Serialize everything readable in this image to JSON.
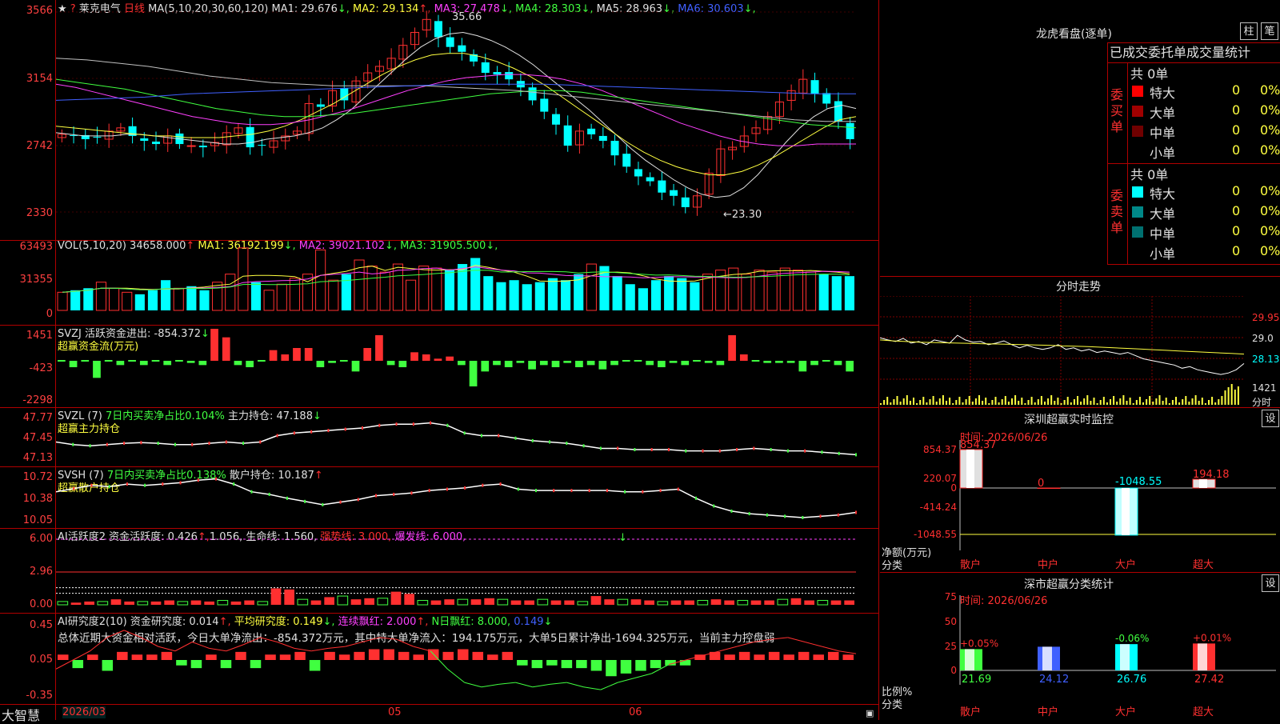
{
  "main": {
    "star": "★",
    "question": "?",
    "stock_name": "莱克电气",
    "period": "日线",
    "ma_params": "MA(5,10,20,30,60,120)",
    "ma": [
      {
        "label": "MA1: 29.676",
        "arrow": "↓",
        "color": "#e0e0e0"
      },
      {
        "label": "MA2: 29.134",
        "arrow": "↑",
        "color": "#ffff40"
      },
      {
        "label": "MA3: 27.478",
        "arrow": "↓",
        "color": "#ff40ff"
      },
      {
        "label": "MA4: 28.303",
        "arrow": "↓",
        "color": "#40ff40"
      },
      {
        "label": "MA5: 28.963",
        "arrow": "↓",
        "color": "#e0e0e0"
      },
      {
        "label": "MA6: 30.603",
        "arrow": "↓",
        "color": "#4060ff"
      }
    ],
    "y_labels": [
      "3566",
      "3154",
      "2742",
      "2330"
    ],
    "high_mark": "35.66",
    "low_mark": "←23.30",
    "closes": [
      28.1,
      28.0,
      27.8,
      27.9,
      28.3,
      28.5,
      28.0,
      27.7,
      27.5,
      28.0,
      27.5,
      27.4,
      27.3,
      27.6,
      28.2,
      28.5,
      27.3,
      27.4,
      27.7,
      28.0,
      28.3,
      30.0,
      29.8,
      30.8,
      30.2,
      31.4,
      31.9,
      32.3,
      32.8,
      33.6,
      34.4,
      35.2,
      34.1,
      33.5,
      33.2,
      32.6,
      31.9,
      31.8,
      31.5,
      31.0,
      30.2,
      29.5,
      28.7,
      27.4,
      28.3,
      28.1,
      27.7,
      26.8,
      26.1,
      25.5,
      25.2,
      24.5,
      24.3,
      23.6,
      24.3,
      25.7,
      27.2,
      27.3,
      28.0,
      28.5,
      29.2,
      30.1,
      30.8,
      31.5,
      30.6,
      30.0,
      28.9,
      27.8
    ],
    "ma_lines": [
      {
        "color": "#e0e0e0",
        "values": [
          28.2,
          28.1,
          28.0,
          28.0,
          28.0,
          28.1,
          28.1,
          28.0,
          27.9,
          27.8,
          27.7,
          27.6,
          27.5,
          27.5,
          27.6,
          27.8,
          27.9,
          28.0,
          28.2,
          28.5,
          29.0,
          29.6,
          30.4,
          31.2,
          32.0,
          32.8,
          33.5,
          34.0,
          34.3,
          34.4,
          34.2,
          33.9,
          33.5,
          33.0,
          32.4,
          31.7,
          31.0,
          30.3,
          29.6,
          28.8,
          28.0,
          27.2,
          26.5,
          25.9,
          25.3,
          24.8,
          24.4,
          24.2,
          24.3,
          24.8,
          25.6,
          26.6,
          27.6,
          28.5,
          29.2,
          29.7,
          29.9,
          29.7
        ]
      },
      {
        "color": "#ffff40",
        "values": [
          28.6,
          28.5,
          28.4,
          28.3,
          28.2,
          28.1,
          28.0,
          28.0,
          27.9,
          27.9,
          27.9,
          28.0,
          28.1,
          28.3,
          28.6,
          29.0,
          29.5,
          30.0,
          30.6,
          31.2,
          31.8,
          32.3,
          32.7,
          33.0,
          33.1,
          33.1,
          32.9,
          32.6,
          32.2,
          31.7,
          31.1,
          30.4,
          29.7,
          29.0,
          28.3,
          27.6,
          27.0,
          26.5,
          26.1,
          25.8,
          25.6,
          25.6,
          25.8,
          26.2,
          26.7,
          27.3,
          27.9,
          28.5,
          29.0,
          29.2
        ]
      },
      {
        "color": "#ff40ff",
        "values": [
          31.2,
          31.0,
          30.7,
          30.4,
          30.1,
          29.8,
          29.5,
          29.2,
          29.0,
          28.8,
          28.7,
          28.7,
          28.8,
          29.0,
          29.3,
          29.6,
          30.0,
          30.4,
          30.8,
          31.1,
          31.4,
          31.6,
          31.7,
          31.8,
          31.8,
          31.7,
          31.5,
          31.2,
          30.8,
          30.3,
          29.8,
          29.3,
          28.8,
          28.4,
          28.0,
          27.7,
          27.5,
          27.4,
          27.4,
          27.5,
          27.5,
          27.5
        ]
      },
      {
        "color": "#40ff40",
        "values": [
          31.5,
          31.3,
          31.1,
          30.9,
          30.6,
          30.3,
          30.0,
          29.7,
          29.5,
          29.3,
          29.2,
          29.2,
          29.3,
          29.4,
          29.6,
          29.8,
          30.0,
          30.2,
          30.4,
          30.6,
          30.7,
          30.8,
          30.8,
          30.7,
          30.5,
          30.3,
          30.1,
          29.9,
          29.7,
          29.5,
          29.3,
          29.1,
          28.9,
          28.7,
          28.6,
          28.5
        ]
      },
      {
        "color": "#c0c0c0",
        "values": [
          32.8,
          32.7,
          32.5,
          32.3,
          32.0,
          31.7,
          31.5,
          31.3,
          31.2,
          31.1,
          31.1,
          31.1,
          31.1,
          31.0,
          30.9,
          30.8,
          30.6,
          30.4,
          30.2,
          30.0,
          29.8,
          29.6,
          29.4,
          29.2,
          29.0,
          28.9,
          28.9
        ]
      },
      {
        "color": "#4060ff",
        "values": [
          30.2,
          30.3,
          30.4,
          30.6,
          30.7,
          30.8,
          30.9,
          31.0,
          31.1,
          31.2,
          31.2,
          31.2,
          31.1,
          31.0,
          30.9,
          30.8,
          30.7,
          30.6,
          30.6
        ]
      }
    ]
  },
  "vol": {
    "header": "VOL(5,10,20)",
    "value": "34658.000",
    "arrow": "↑",
    "ma": [
      {
        "label": "MA1: 36192.199",
        "arrow": "↓",
        "color": "#ffff40"
      },
      {
        "label": "MA2: 39021.102",
        "arrow": "↓",
        "color": "#ff40ff"
      },
      {
        "label": "MA3: 31905.500",
        "arrow": "↓",
        "color": "#40ff40"
      }
    ],
    "y_labels": [
      "63493",
      "31355",
      "0"
    ],
    "values": [
      18000,
      20000,
      22000,
      28000,
      22000,
      18000,
      16000,
      20000,
      30000,
      22000,
      24000,
      20000,
      28000,
      36000,
      62000,
      28000,
      20000,
      26000,
      32000,
      36000,
      60000,
      30000,
      36000,
      50000,
      44000,
      38000,
      46000,
      30000,
      44000,
      42000,
      40000,
      46000,
      52000,
      34000,
      28000,
      30000,
      26000,
      28000,
      32000,
      30000,
      36000,
      46000,
      44000,
      34000,
      26000,
      22000,
      30000,
      34000,
      32000,
      28000,
      36000,
      40000,
      42000,
      36000,
      40000,
      38000,
      42000,
      40000,
      38000,
      36000,
      34000,
      34000
    ]
  },
  "svzj": {
    "name": "SVZJ",
    "label": "活跃资金进出: -854.372",
    "arrow": "↓",
    "title": "超赢资金流(万元)",
    "y_labels": [
      "1451",
      "-423",
      "-2298"
    ],
    "values": [
      0,
      -300,
      0,
      -800,
      0,
      -200,
      0,
      -200,
      0,
      -200,
      0,
      -100,
      -200,
      1500,
      1100,
      -200,
      -300,
      0,
      500,
      300,
      600,
      600,
      -300,
      -100,
      0,
      -500,
      600,
      1200,
      -200,
      -300,
      400,
      300,
      100,
      200,
      -200,
      -1200,
      -500,
      -200,
      -300,
      -100,
      -400,
      -200,
      -300,
      -100,
      -300,
      -200,
      -400,
      -200,
      0,
      0,
      -200,
      -300,
      -100,
      -200,
      0,
      -100,
      -200,
      1200,
      300,
      0,
      -100,
      -100,
      -100,
      -500,
      -200,
      0,
      -200,
      -500
    ]
  },
  "svzl": {
    "name": "SVZL (7)",
    "label1": "7日内买卖净占比0.104%",
    "label2": "主力持仓: 47.188",
    "arrow": "↓",
    "title": "超赢主力持仓",
    "y_labels": [
      "47.77",
      "47.45",
      "47.13"
    ],
    "values": [
      47.4,
      47.36,
      47.34,
      47.36,
      47.38,
      47.39,
      47.38,
      47.36,
      47.36,
      47.38,
      47.4,
      47.38,
      47.4,
      47.5,
      47.54,
      47.56,
      47.58,
      47.6,
      47.62,
      47.66,
      47.68,
      47.68,
      47.7,
      47.66,
      47.54,
      47.5,
      47.5,
      47.46,
      47.42,
      47.4,
      47.38,
      47.34,
      47.3,
      47.3,
      47.28,
      47.28,
      47.28,
      47.26,
      47.26,
      47.26,
      47.28,
      47.3,
      47.28,
      47.26,
      47.26,
      47.24,
      47.22,
      47.2
    ]
  },
  "svsh": {
    "name": "SVSH (7)",
    "label1": "7日内买卖净占比0.138%",
    "label2": "散户持仓: 10.187",
    "arrow": "↑",
    "title": "超赢散户持仓",
    "y_labels": [
      "10.72",
      "10.38",
      "10.05"
    ],
    "values": [
      10.5,
      10.55,
      10.6,
      10.58,
      10.62,
      10.6,
      10.62,
      10.64,
      10.68,
      10.7,
      10.62,
      10.5,
      10.46,
      10.4,
      10.35,
      10.3,
      10.34,
      10.38,
      10.44,
      10.46,
      10.48,
      10.52,
      10.54,
      10.56,
      10.6,
      10.62,
      10.54,
      10.52,
      10.52,
      10.52,
      10.52,
      10.52,
      10.5,
      10.5,
      10.52,
      10.54,
      10.4,
      10.28,
      10.2,
      10.16,
      10.14,
      10.12,
      10.1,
      10.12,
      10.14,
      10.18
    ]
  },
  "ai1": {
    "name": "AI活跃度2",
    "label1": "资金活跃度: 0.426",
    "sep": "↑,",
    "label2": "1.056,",
    "label3": "生命线: 1.560,",
    "label4": "强势线: 3.000,",
    "label5": "爆发线: 6.000,",
    "y_labels": [
      "6.00",
      "2.96",
      "0.00"
    ],
    "values": [
      0.3,
      0.2,
      0.3,
      0.3,
      0.5,
      0.3,
      0.3,
      0.3,
      0.4,
      0.3,
      0.4,
      0.3,
      0.4,
      0.3,
      0.4,
      0.3,
      1.5,
      1.4,
      0.5,
      0.4,
      0.7,
      0.8,
      0.5,
      0.6,
      0.6,
      1.2,
      1.0,
      0.4,
      0.4,
      0.5,
      0.5,
      0.5,
      0.6,
      0.5,
      0.4,
      0.4,
      0.5,
      0.4,
      0.4,
      0.3,
      0.8,
      0.5,
      0.5,
      0.5,
      0.4,
      0.3,
      0.4,
      0.4,
      0.4,
      0.5,
      0.4,
      0.4,
      0.4,
      0.4,
      0.5,
      0.6,
      0.4,
      0.4,
      0.4,
      0.4
    ]
  },
  "ai2": {
    "name": "AI研究度2(10)",
    "label1": "资金研究度: 0.014",
    "label2": "平均研究度: 0.149",
    "label3": "连续飘红: 2.000",
    "label4": "N日飘红: 8.000,",
    "label5": "0.149",
    "summary": "总体近期大资金相对活跃，今日大单净流出：-854.372万元，其中特大单净流入：194.175万元，大单5日累计净出-1694.325万元，当前主力控盘弱",
    "y_labels": [
      "0.45",
      "0.05",
      "-0.35"
    ],
    "bars": [
      0.02,
      -0.03,
      0.02,
      -0.04,
      0.03,
      0.02,
      0.02,
      0.03,
      -0.02,
      -0.03,
      0.02,
      -0.03,
      0.03,
      -0.03,
      0.02,
      0.02,
      0.03,
      -0.04,
      0.03,
      0.02,
      0.03,
      0.04,
      0.04,
      0.03,
      0.02,
      0.04,
      0.03,
      0.04,
      0.03,
      0.02,
      0.03,
      -0.02,
      -0.03,
      -0.02,
      -0.03,
      -0.03,
      -0.04,
      -0.06,
      -0.05,
      -0.04,
      -0.03,
      -0.02,
      -0.02,
      0.02,
      0.03,
      0.02,
      0.03,
      0.02,
      0.03,
      0.02,
      0.03,
      0.02,
      0.03,
      0.02
    ],
    "line": [
      -0.05,
      0.05,
      0.15,
      0.3,
      0.38,
      0.3,
      0.2,
      0.15,
      0.25,
      0.18,
      0.15,
      0.22,
      0.3,
      0.25,
      0.18,
      0.15,
      0.18,
      0.2,
      0.25,
      0.3,
      0.28,
      0.2,
      0.15,
      -0.05,
      -0.2,
      -0.25,
      -0.22,
      -0.2,
      -0.25,
      -0.22,
      -0.2,
      -0.25,
      -0.28,
      -0.2,
      -0.15,
      -0.1,
      0.0,
      0.05,
      0.1,
      0.15,
      0.2,
      0.25,
      0.28,
      0.3,
      0.25,
      0.2,
      0.15,
      0.12
    ]
  },
  "dates": {
    "start": "2026/03",
    "m5": "05",
    "m6": "06"
  },
  "footer_logo": "大智慧",
  "dragon": {
    "title": "龙虎看盘(逐单)",
    "btn1": "柱",
    "btn2": "笔",
    "table_title": "已成交委托单成交量统计",
    "buy_side": "委买单",
    "sell_side": "委卖单",
    "buy_total": "共 0单",
    "sell_total": "共 0单",
    "buy_rows": [
      {
        "name": "特大",
        "val": "0",
        "pct": "0%",
        "color": "#ff0000"
      },
      {
        "name": "大单",
        "val": "0",
        "pct": "0%",
        "color": "#a00000"
      },
      {
        "name": "中单",
        "val": "0",
        "pct": "0%",
        "color": "#700000"
      },
      {
        "name": "小单",
        "val": "0",
        "pct": "0%",
        "color": ""
      }
    ],
    "sell_rows": [
      {
        "name": "特大",
        "val": "0",
        "pct": "0%",
        "color": "#00ffff"
      },
      {
        "name": "大单",
        "val": "0",
        "pct": "0%",
        "color": "#008888"
      },
      {
        "name": "中单",
        "val": "0",
        "pct": "0%",
        "color": "#007070"
      },
      {
        "name": "小单",
        "val": "0",
        "pct": "0%",
        "color": ""
      }
    ]
  },
  "fenshi": {
    "title": "分时走势",
    "y_labels": [
      "29.95",
      "29.0",
      "28.13",
      "1421"
    ],
    "footer": "分时",
    "price": [
      28.62,
      28.55,
      28.5,
      28.6,
      28.45,
      28.5,
      28.4,
      28.55,
      28.5,
      28.45,
      28.7,
      28.55,
      28.48,
      28.5,
      28.4,
      28.45,
      28.52,
      28.4,
      28.3,
      28.38,
      28.3,
      28.25,
      28.3,
      28.4,
      28.25,
      28.3,
      28.2,
      28.25,
      28.15,
      28.2,
      28.15,
      28.1,
      28.15,
      28.05,
      27.95,
      27.9,
      27.85,
      27.8,
      27.75,
      27.65,
      27.7,
      27.6,
      27.55,
      27.5,
      27.45,
      27.5,
      27.6,
      27.8
    ],
    "avg": [
      28.55,
      28.52,
      28.5,
      28.48,
      28.47,
      28.46,
      28.45,
      28.44,
      28.43,
      28.42,
      28.41,
      28.4,
      28.39,
      28.38,
      28.36,
      28.35,
      28.34,
      28.32,
      28.3,
      28.28,
      28.26,
      28.24,
      28.22,
      28.2,
      28.18,
      28.16,
      28.14,
      28.12,
      28.1
    ]
  },
  "sz_monitor": {
    "title": "深圳超赢实时监控",
    "btn": "设",
    "time": "时间: 2026/06/26",
    "y_labels": [
      "854.37",
      "220.07",
      "0",
      "-414.24",
      "-1048.55"
    ],
    "label_net": "净额(万元)",
    "label_cat": "分类",
    "cats": [
      "散户",
      "中户",
      "大户",
      "超大"
    ],
    "vals": [
      854.37,
      0,
      -1048.55,
      194.18
    ],
    "val_labels": [
      "854.37",
      "0",
      "-1048.55",
      "194.18"
    ]
  },
  "sz_class": {
    "title": "深市超赢分类统计",
    "btn": "设",
    "time": "时间: 2026/06/26",
    "y_labels": [
      "75",
      "50",
      "25",
      "0"
    ],
    "label_ratio": "比例%",
    "label_cat": "分类",
    "cats": [
      "散户",
      "中户",
      "大户",
      "超大"
    ],
    "pcts": [
      21.69,
      24.12,
      26.76,
      27.42
    ],
    "pct_labels": [
      "21.69",
      "24.12",
      "26.76",
      "27.42"
    ],
    "top_labels": [
      "+0.05%",
      "",
      "-0.06%",
      "+0.01%"
    ],
    "colors": [
      "#40ff40",
      "#4060ff",
      "#00ffff",
      "#ff3030"
    ]
  }
}
